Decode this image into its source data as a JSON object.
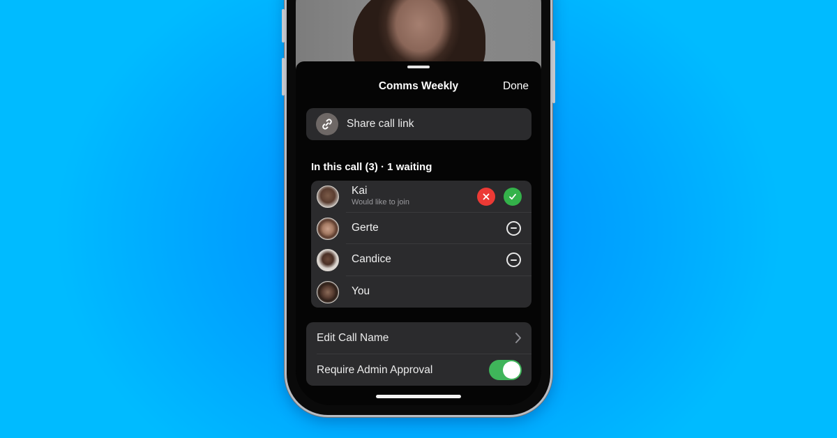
{
  "sheet": {
    "title": "Comms Weekly",
    "done_label": "Done"
  },
  "share": {
    "icon": "link-icon",
    "label": "Share call link"
  },
  "participants": {
    "header": "In this call (3) · 1 waiting",
    "items": [
      {
        "name": "Kai",
        "subtitle": "Would like to join",
        "status": "waiting",
        "actions": [
          "decline",
          "accept"
        ]
      },
      {
        "name": "Gerte",
        "status": "in-call",
        "actions": [
          "remove"
        ]
      },
      {
        "name": "Candice",
        "status": "in-call",
        "actions": [
          "remove"
        ]
      },
      {
        "name": "You",
        "status": "self",
        "actions": []
      }
    ]
  },
  "settings": {
    "items": [
      {
        "label": "Edit Call Name",
        "control": "chevron-right-icon"
      },
      {
        "label": "Require Admin Approval",
        "control": "toggle",
        "value": true
      }
    ]
  },
  "colors": {
    "decline": "#ec3a35",
    "accept": "#34b24a",
    "toggle_on": "#3fb55a",
    "card_bg": "#2b2b2d",
    "background": "#00a8ff"
  }
}
